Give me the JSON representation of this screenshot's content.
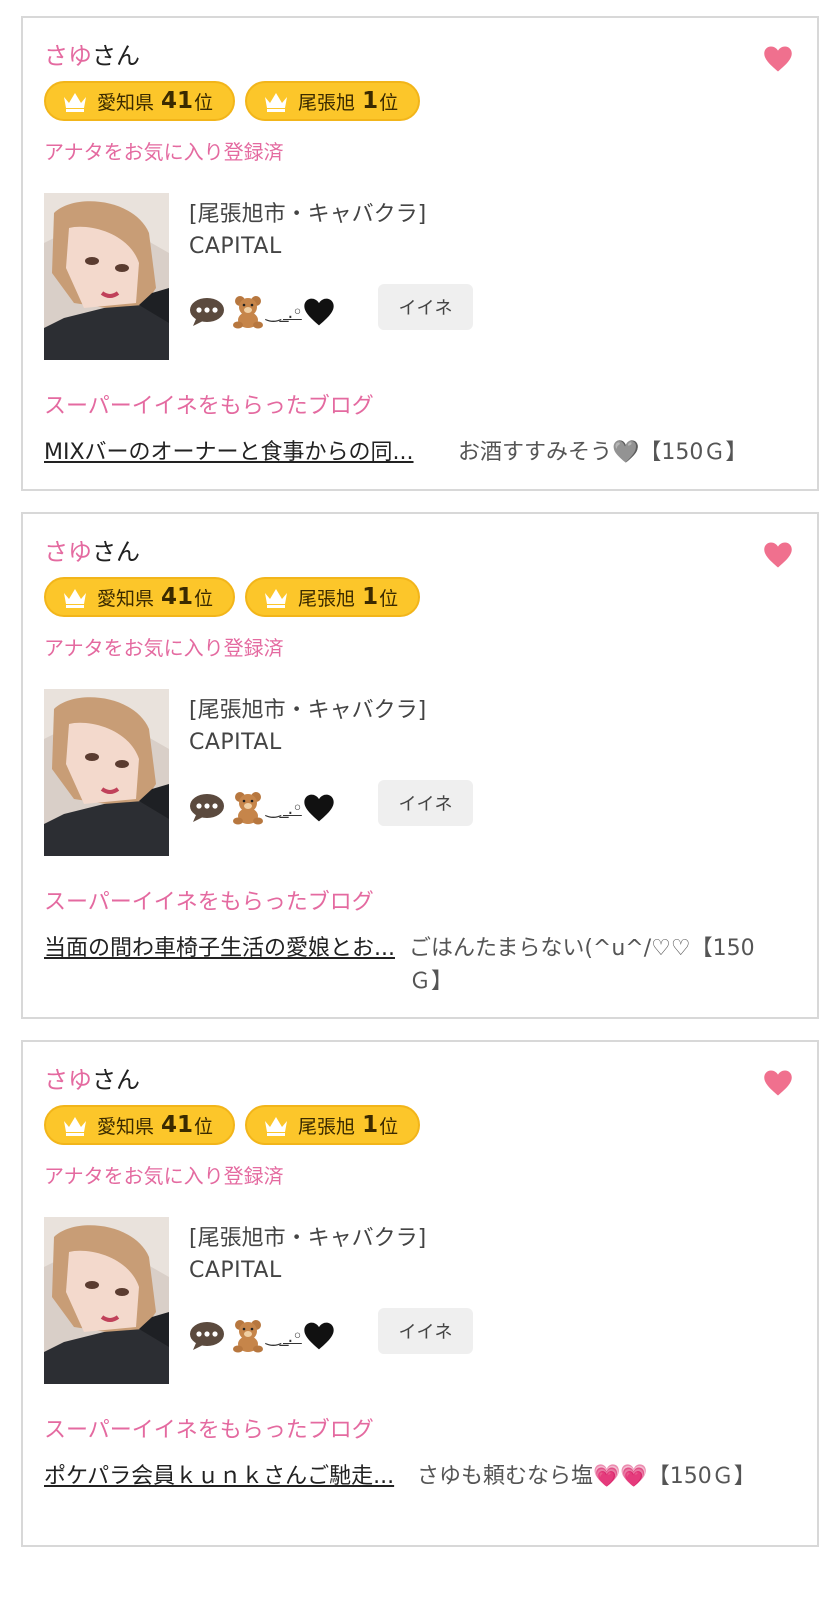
{
  "colors": {
    "accent_pink": "#e46aa0",
    "heart": "#f0708e",
    "badge_bg": "#fcc62a",
    "iine_bg": "#efefef"
  },
  "cards": [
    {
      "name": "さゆ",
      "name_suffix": "さん",
      "badges": [
        {
          "icon": "crown-icon",
          "label": "愛知県",
          "rank": "41",
          "unit": "位"
        },
        {
          "icon": "crown-icon",
          "label": "尾張旭",
          "rank": "1",
          "unit": "位"
        }
      ],
      "favorite_text": "アナタをお気に入り登録済",
      "area": "[尾張旭市・キャバクラ]",
      "shop": "CAPITAL",
      "status_text": "‿_.◦",
      "iine_label": "イイネ",
      "blog_heading": "スーパーイイネをもらったブログ",
      "blog_title": "MIXバーのオーナーと食事からの同...",
      "blog_comment": "お酒すすみそう🩶【150Ｇ】"
    },
    {
      "name": "さゆ",
      "name_suffix": "さん",
      "badges": [
        {
          "icon": "crown-icon",
          "label": "愛知県",
          "rank": "41",
          "unit": "位"
        },
        {
          "icon": "crown-icon",
          "label": "尾張旭",
          "rank": "1",
          "unit": "位"
        }
      ],
      "favorite_text": "アナタをお気に入り登録済",
      "area": "[尾張旭市・キャバクラ]",
      "shop": "CAPITAL",
      "status_text": "‿_.◦",
      "iine_label": "イイネ",
      "blog_heading": "スーパーイイネをもらったブログ",
      "blog_title": "当面の間わ車椅子生活の愛娘とお...",
      "blog_comment": "ごはんたまらない(^u^/♡♡【150Ｇ】"
    },
    {
      "name": "さゆ",
      "name_suffix": "さん",
      "badges": [
        {
          "icon": "crown-icon",
          "label": "愛知県",
          "rank": "41",
          "unit": "位"
        },
        {
          "icon": "crown-icon",
          "label": "尾張旭",
          "rank": "1",
          "unit": "位"
        }
      ],
      "favorite_text": "アナタをお気に入り登録済",
      "area": "[尾張旭市・キャバクラ]",
      "shop": "CAPITAL",
      "status_text": "‿_.◦",
      "iine_label": "イイネ",
      "blog_heading": "スーパーイイネをもらったブログ",
      "blog_title": "ポケパラ会員ｋｕｎｋさんご馳走...",
      "blog_comment": "さゆも頼むなら塩💗💗【150Ｇ】"
    }
  ]
}
